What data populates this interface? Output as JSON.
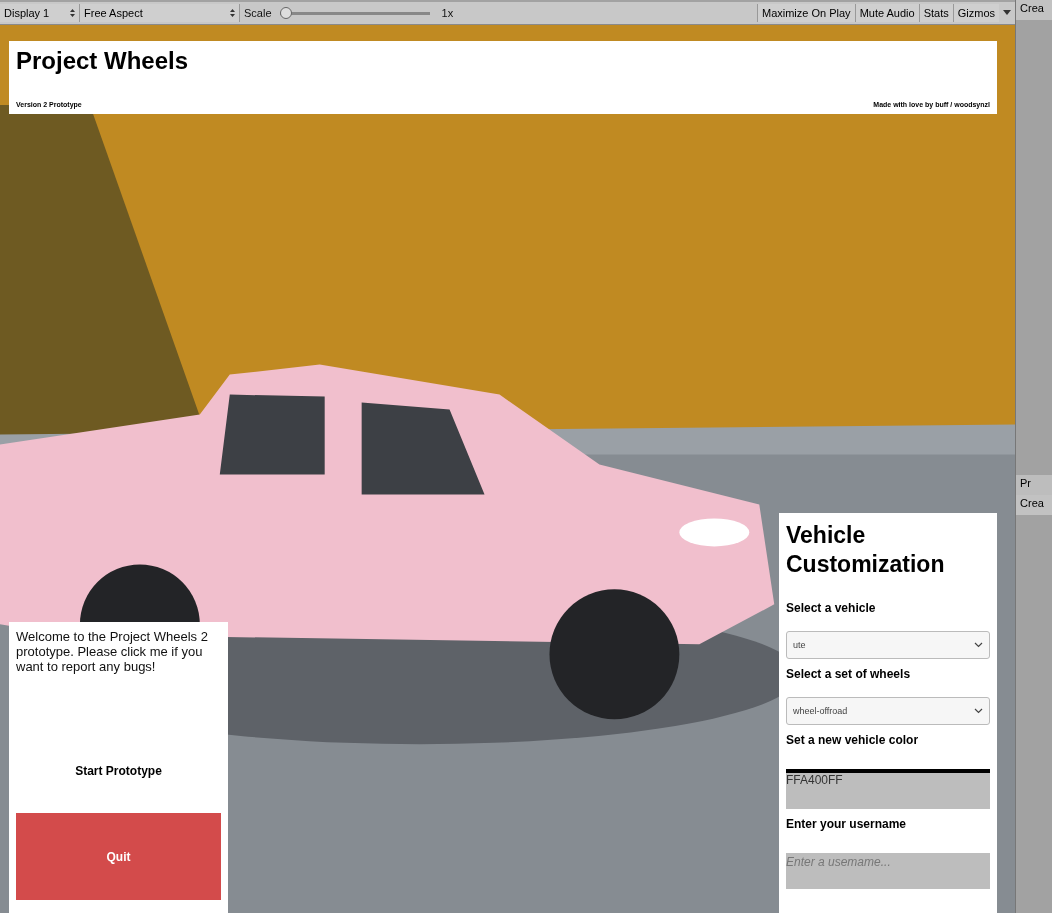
{
  "toolbar": {
    "display": "Display 1",
    "aspect": "Free Aspect",
    "scale_label": "Scale",
    "scale": {
      "level": 0,
      "reading": "1x"
    },
    "buttons": [
      "Maximize On Play",
      "Mute Audio",
      "Stats",
      "Gizmos"
    ]
  },
  "header": {
    "title": "Project Wheels",
    "version": "Version 2 Prototype",
    "credits": "Made with love by buff / woodsynzl"
  },
  "welcome": {
    "message": "Welcome to the Project Wheels 2 prototype. Please click me if you want to report any bugs!",
    "start": "Start Prototype",
    "quit": "Quit"
  },
  "customization": {
    "title": "Vehicle Customization",
    "fields": [
      {
        "kind": "select",
        "label": "Select a vehicle",
        "value": "ute"
      },
      {
        "kind": "select",
        "label": "Select a set of wheels",
        "value": "wheel-offroad"
      },
      {
        "kind": "color",
        "label": "Set a new vehicle color",
        "value": "FFA400FF"
      },
      {
        "kind": "text",
        "label": "Enter your username",
        "placeholder": "Enter a usemame..."
      }
    ]
  },
  "side_panel": {
    "hierarchy_button": "Crea",
    "project_tab": "Pr",
    "project_button": "Crea"
  }
}
